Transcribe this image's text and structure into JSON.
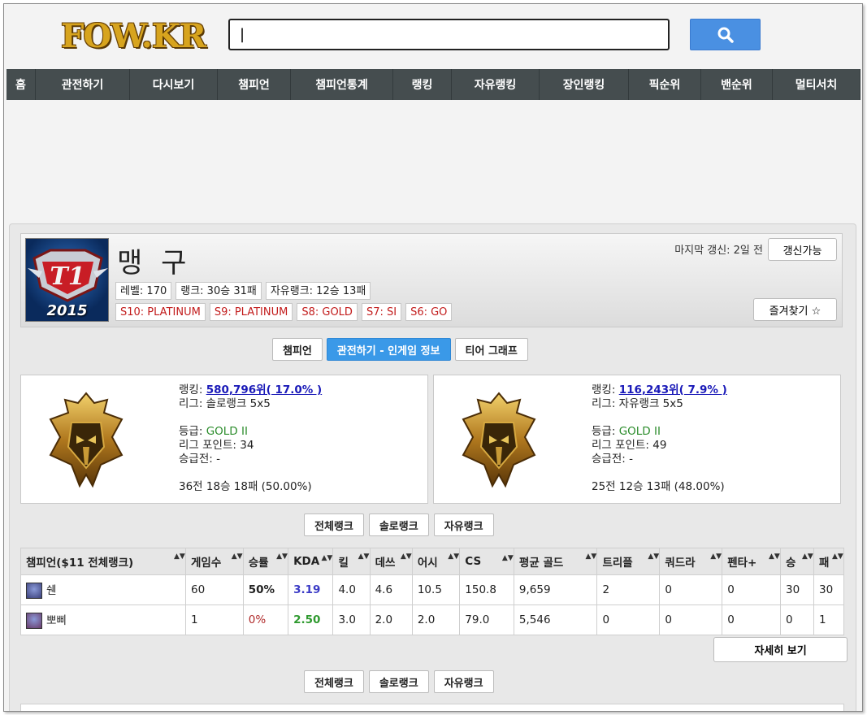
{
  "header": {
    "logo": "FOW.KR",
    "search_value": "|"
  },
  "nav": [
    {
      "label": "홈",
      "w": 36
    },
    {
      "label": "관전하기",
      "w": 116
    },
    {
      "label": "다시보기",
      "w": 108
    },
    {
      "label": "챔피언",
      "w": 90
    },
    {
      "label": "챔피언통계",
      "w": 126
    },
    {
      "label": "랭킹",
      "w": 72
    },
    {
      "label": "자유랭킹",
      "w": 108
    },
    {
      "label": "장인랭킹",
      "w": 110
    },
    {
      "label": "픽순위",
      "w": 89
    },
    {
      "label": "밴순위",
      "w": 88
    },
    {
      "label": "멀티서치",
      "w": 108
    }
  ],
  "profile": {
    "name": "맹 구",
    "icon_year": "2015",
    "level": "레벨: 170",
    "rank_record": "랭크: 30승 31패",
    "flex_record": "자유랭크: 12승 13패",
    "seasons": [
      "S10: PLATINUM",
      "S9: PLATINUM",
      "S8: GOLD",
      "S7: SI",
      "S6: GO"
    ],
    "last_update": "마지막 갱신: 2일 전",
    "refresh_label": "갱신가능",
    "favorite_label": "즐겨찾기 ☆"
  },
  "tabs": [
    "챔피언",
    "관전하기 - 인게임 정보",
    "티어 그래프"
  ],
  "solo": {
    "ranking_label": "랭킹: ",
    "ranking_value": "580,796위( 17.0% )",
    "league": "리그: 솔로랭크 5x5",
    "tier_label": "등급: ",
    "tier_value": "GOLD II",
    "points": "리그 포인트: 34",
    "promo": "승급전: -",
    "record": "36전 18승 18패 (50.00%)"
  },
  "flex": {
    "ranking_label": "랭킹: ",
    "ranking_value": "116,243위( 7.9% )",
    "league": "리그: 자유랭크 5x5",
    "tier_label": "등급: ",
    "tier_value": "GOLD II",
    "points": "리그 포인트: 49",
    "promo": "승급전: -",
    "record": "25전 12승 13패 (48.00%)"
  },
  "filters": [
    "전체랭크",
    "솔로랭크",
    "자유랭크"
  ],
  "table": {
    "headers": [
      "챔피언($11 전체랭크)",
      "게임수",
      "승률",
      "KDA",
      "킬",
      "데쓰",
      "어시",
      "CS",
      "평균 골드",
      "트리플",
      "쿼드라",
      "펜타+",
      "승",
      "패"
    ],
    "rows": [
      {
        "champion": "쉔",
        "games": "60",
        "winrate": "50%",
        "kda": "3.19",
        "kills": "4.0",
        "deaths": "4.6",
        "assists": "10.5",
        "cs": "150.8",
        "gold": "9,659",
        "triple": "2",
        "quadra": "0",
        "penta": "0",
        "wins": "30",
        "losses": "30"
      },
      {
        "champion": "뽀삐",
        "games": "1",
        "winrate": "0%",
        "kda": "2.50",
        "kills": "3.0",
        "deaths": "2.0",
        "assists": "2.0",
        "cs": "79.0",
        "gold": "5,546",
        "triple": "0",
        "quadra": "0",
        "penta": "0",
        "wins": "0",
        "losses": "1"
      }
    ]
  },
  "detail_label": "자세히 보기",
  "colors": {
    "nav_bg": "#454d4f",
    "accent_blue": "#3a99e8",
    "search_button": "#4a90e2",
    "season_red": "#c21b1b",
    "tier_green": "#2b8c2b"
  }
}
